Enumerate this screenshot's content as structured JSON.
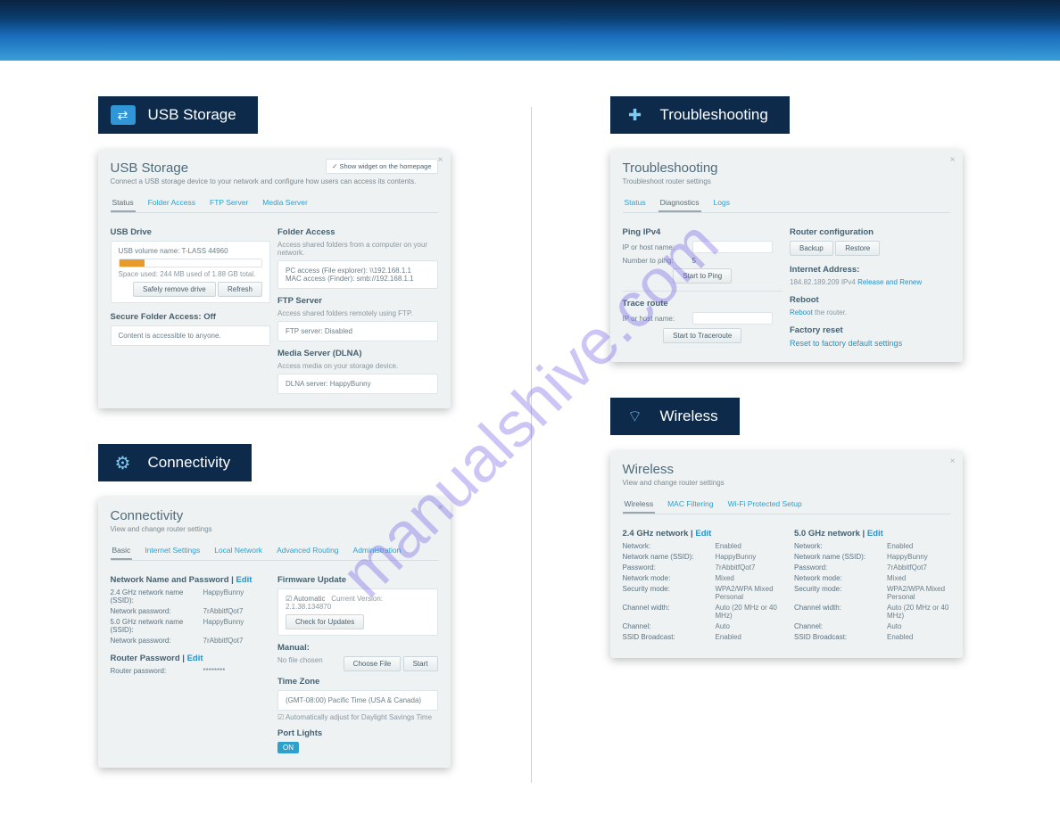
{
  "watermark": "manualshive.com",
  "sections": {
    "usb": {
      "badge": "USB Storage",
      "title": "USB Storage",
      "sub": "Connect a USB storage device to your network and configure how users can access its contents.",
      "homepageChk": "Show widget on the homepage",
      "tabs": [
        "Status",
        "Folder Access",
        "FTP Server",
        "Media Server"
      ],
      "usbDriveLabel": "USB Drive",
      "volumeName": "USB volume name: T-LASS 44960",
      "spaceUsed": "Space used: 244 MB used of 1.88 GB total.",
      "btnSafeRemove": "Safely remove drive",
      "btnRefresh": "Refresh",
      "secureFolderLabel": "Secure Folder Access: Off",
      "secureFolderNote": "Content is accessible to anyone.",
      "folderAccessLabel": "Folder Access",
      "folderAccessSub": "Access shared folders from a computer on your network.",
      "folderAccessBox": "PC access (File explorer): \\\\192.168.1.1\nMAC access (Finder): smb://192.168.1.1",
      "ftpLabel": "FTP Server",
      "ftpSub": "Access shared folders remotely using FTP.",
      "ftpBox": "FTP server: Disabled",
      "mediaLabel": "Media Server (DLNA)",
      "mediaSub": "Access media on your storage device.",
      "mediaBox": "DLNA server: HappyBunny"
    },
    "conn": {
      "badge": "Connectivity",
      "title": "Connectivity",
      "sub": "View and change router settings",
      "tabs": [
        "Basic",
        "Internet Settings",
        "Local Network",
        "Advanced Routing",
        "Administration"
      ],
      "netNamePwd": "Network Name and Password",
      "edit": "Edit",
      "row24name_l": "2.4 GHz network name (SSID):",
      "row24name_v": "HappyBunny",
      "row24pwd_l": "Network password:",
      "row24pwd_v": "7rAbbitfQot7",
      "row50name_l": "5.0 GHz network name (SSID):",
      "row50name_v": "HappyBunny",
      "row50pwd_l": "Network password:",
      "row50pwd_v": "7rAbbitfQot7",
      "routerPwd": "Router Password",
      "routerPwd_l": "Router password:",
      "fwLabel": "Firmware Update",
      "fwAuto": "Automatic",
      "fwCurrent": "Current Version: 2.1.38.134870",
      "fwBtn": "Check for Updates",
      "manualLabel": "Manual:",
      "manualNote": "No file chosen",
      "btnChoose": "Choose File",
      "btnStart": "Start",
      "tzLabel": "Time Zone",
      "tzValue": "(GMT-08:00) Pacific Time (USA & Canada)",
      "tzAuto": "Automatically adjust for Daylight Savings Time",
      "portLights": "Port Lights",
      "on": "ON"
    },
    "trouble": {
      "badge": "Troubleshooting",
      "title": "Troubleshooting",
      "sub": "Troubleshoot router settings",
      "tabs": [
        "Status",
        "Diagnostics",
        "Logs"
      ],
      "pingLabel": "Ping IPv4",
      "pingHost": "IP or host name:",
      "pingNum": "Number to ping:",
      "pingNumVal": "5",
      "btnPing": "Start to Ping",
      "traceLabel": "Trace route",
      "traceHost": "IP or host name:",
      "btnTrace": "Start to Traceroute",
      "routerConfig": "Router configuration",
      "btnBackup": "Backup",
      "btnRestore": "Restore",
      "inetAddr": "Internet Address:",
      "inetVal": "184.82.189.209 IPv4",
      "inetLink": "Release and Renew",
      "rebootLabel": "Reboot",
      "rebootLink": "Reboot",
      "rebootNote": "the router.",
      "factoryLabel": "Factory reset",
      "factoryLink": "Reset to factory default settings"
    },
    "wless": {
      "badge": "Wireless",
      "title": "Wireless",
      "sub": "View and change router settings",
      "tabs": [
        "Wireless",
        "MAC Filtering",
        "Wi-Fi Protected Setup"
      ],
      "net24": "2.4 GHz network",
      "net50": "5.0 GHz network",
      "edit": "Edit",
      "rows": [
        {
          "l": "Network:",
          "v": "Enabled"
        },
        {
          "l": "Network name (SSID):",
          "v": "HappyBunny"
        },
        {
          "l": "Password:",
          "v": "7rAbbitfQot7"
        },
        {
          "l": "Network mode:",
          "v": "Mixed"
        },
        {
          "l": "Security mode:",
          "v": "WPA2/WPA Mixed Personal"
        },
        {
          "l": "Channel width:",
          "v": "Auto (20 MHz or 40 MHz)"
        },
        {
          "l": "Channel:",
          "v": "Auto"
        },
        {
          "l": "SSID Broadcast:",
          "v": "Enabled"
        }
      ],
      "rows50": [
        {
          "l": "Network:",
          "v": "Enabled"
        },
        {
          "l": "Network name (SSID):",
          "v": "HappyBunny"
        },
        {
          "l": "Password:",
          "v": "7rAbbitfQot7"
        },
        {
          "l": "Network mode:",
          "v": "Mixed"
        },
        {
          "l": "Security mode:",
          "v": "WPA2/WPA Mixed Personal"
        },
        {
          "l": "Channel width:",
          "v": "Auto (20 MHz or 40 MHz)"
        },
        {
          "l": "Channel:",
          "v": "Auto"
        },
        {
          "l": "SSID Broadcast:",
          "v": "Enabled"
        }
      ]
    }
  }
}
